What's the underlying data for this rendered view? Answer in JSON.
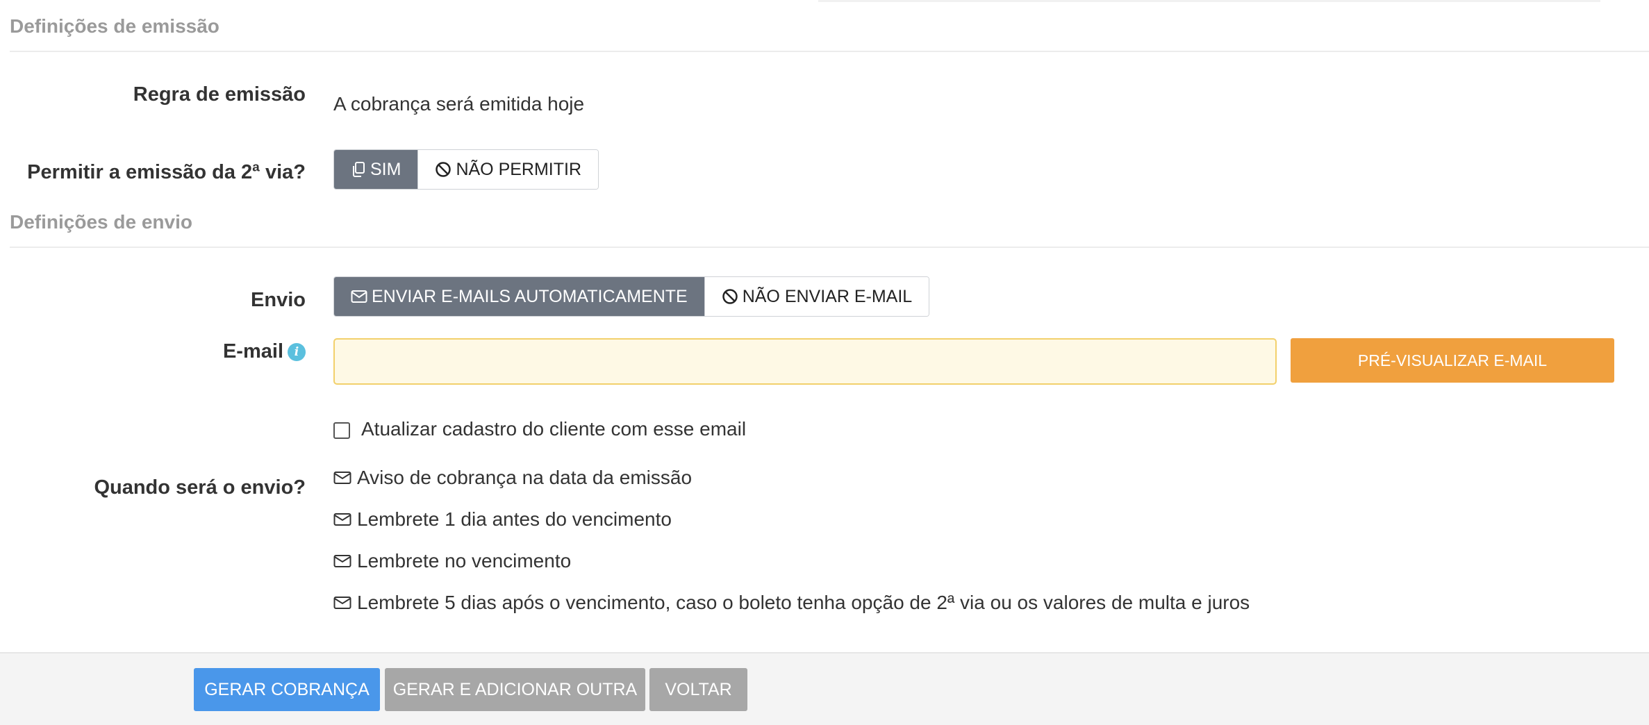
{
  "emission": {
    "section_title": "Definições de emissão",
    "rule_label": "Regra de emissão",
    "rule_value": "A cobrança será emitida hoje",
    "second_copy_label": "Permitir a emissão da 2ª via?",
    "second_copy_options": [
      "SIM",
      "NÃO PERMITIR"
    ],
    "second_copy_selected": "SIM"
  },
  "sending": {
    "section_title": "Definições de envio",
    "send_label": "Envio",
    "send_options": [
      "ENVIAR E-MAILS AUTOMATICAMENTE",
      "NÃO ENVIAR E-MAIL"
    ],
    "send_selected": "ENVIAR E-MAILS AUTOMATICAMENTE",
    "email_label": "E-mail",
    "email_value": "",
    "preview_button": "PRÉ-VISUALIZAR E-MAIL",
    "update_checkbox_label": "Atualizar cadastro do cliente com esse email",
    "update_checkbox_checked": false,
    "when_label": "Quando será o envio?",
    "when_items": [
      "Aviso de cobrança na data da emissão",
      "Lembrete 1 dia antes do vencimento",
      "Lembrete no vencimento",
      "Lembrete 5 dias após o vencimento, caso o boleto tenha opção de 2ª via ou os valores de multa e juros"
    ]
  },
  "footer": {
    "generate": "GERAR COBRANÇA",
    "generate_add": "GERAR E ADICIONAR OUTRA",
    "back": "VOLTAR"
  },
  "colors": {
    "active_segment": "#6c7480",
    "preview_button": "#f0a03e",
    "primary_button": "#4a97ea",
    "secondary_button": "#a7a7a7",
    "email_field_bg": "#fef9e5",
    "info_icon": "#5bc0de"
  }
}
